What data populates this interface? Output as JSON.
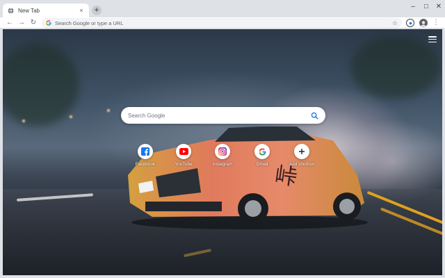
{
  "browser": {
    "tab": {
      "title": "New Tab",
      "close_glyph": "×",
      "favicon": "globe-icon"
    },
    "new_tab_glyph": "+",
    "window_controls": {
      "minimize": "–",
      "maximize": "□",
      "close": "✕"
    }
  },
  "toolbar": {
    "back_glyph": "←",
    "forward_glyph": "→",
    "reload_glyph": "↻",
    "omnibox_placeholder": "Search Google or type a URL",
    "bookmark_glyph": "☆",
    "menu_glyph": "⋮",
    "extension_icon": "extension-icon",
    "profile_icon": "profile-avatar-icon"
  },
  "newtab": {
    "search_placeholder": "Search Google",
    "settings_icon": "hamburger-menu-icon",
    "shortcuts": [
      {
        "label": "Facebook",
        "icon": "facebook-icon",
        "color": "#1877f2"
      },
      {
        "label": "YouTube",
        "icon": "youtube-icon",
        "color": "#ff0000"
      },
      {
        "label": "Instagram",
        "icon": "instagram-icon",
        "color": "#c13584"
      },
      {
        "label": "Gmail",
        "icon": "google-icon",
        "color": "#4285f4"
      },
      {
        "label": "Add shortcut",
        "icon": "plus-icon",
        "color": "#202124"
      }
    ]
  },
  "colors": {
    "tabstrip": "#dee1e6",
    "accent_blue": "#1a73e8"
  }
}
